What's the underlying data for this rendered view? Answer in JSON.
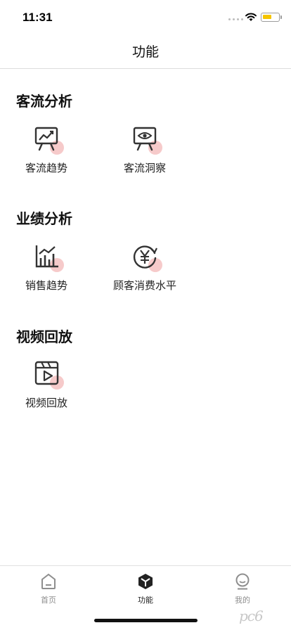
{
  "status_bar": {
    "time": "11:31"
  },
  "nav": {
    "title": "功能"
  },
  "sections": [
    {
      "title": "客流分析",
      "items": [
        {
          "label": "客流趋势",
          "icon": "trend-chart-board-icon"
        },
        {
          "label": "客流洞察",
          "icon": "eye-board-icon"
        }
      ]
    },
    {
      "title": "业绩分析",
      "items": [
        {
          "label": "销售趋势",
          "icon": "bar-chart-icon"
        },
        {
          "label": "顾客消费水平",
          "icon": "yen-refresh-icon"
        }
      ]
    },
    {
      "title": "视频回放",
      "items": [
        {
          "label": "视频回放",
          "icon": "video-play-icon"
        }
      ]
    }
  ],
  "tabs": [
    {
      "label": "首页",
      "icon": "home-icon",
      "active": false
    },
    {
      "label": "功能",
      "icon": "cube-icon",
      "active": true
    },
    {
      "label": "我的",
      "icon": "user-icon",
      "active": false
    }
  ],
  "colors": {
    "accent_blob": "#f4c1c1",
    "tab_active": "#222222",
    "tab_inactive": "#8e8e8e",
    "battery": "#f5c400"
  },
  "watermark": "pc6"
}
